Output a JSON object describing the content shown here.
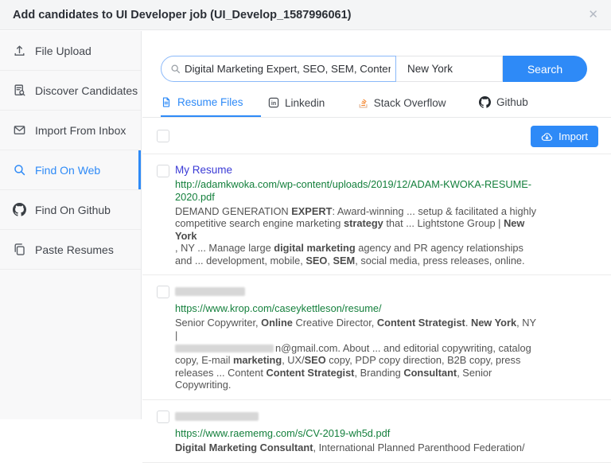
{
  "header": {
    "title": "Add candidates to UI Developer job (UI_Develop_1587996061)",
    "close_icon": "close-icon",
    "close_glyph": "✕"
  },
  "colors": {
    "accent_blue": "#2e8af7",
    "link_blue": "#3b3bd6",
    "url_green": "#15803d",
    "snippet_gray": "#545454",
    "stackoverflow_orange": "#f48024"
  },
  "sidebar": {
    "items": [
      {
        "label": "File Upload",
        "icon": "upload-icon",
        "active": false
      },
      {
        "label": "Discover Candidates",
        "icon": "document-search-icon",
        "active": false
      },
      {
        "label": "Import From Inbox",
        "icon": "envelope-icon",
        "active": false
      },
      {
        "label": "Find On Web",
        "icon": "search-icon",
        "active": true
      },
      {
        "label": "Find On Github",
        "icon": "github-icon",
        "active": false
      },
      {
        "label": "Paste Resumes",
        "icon": "clipboard-icon",
        "active": false
      }
    ]
  },
  "search": {
    "keyword_value": "Digital Marketing Expert, SEO, SEM, Conten",
    "keyword_icon": "search-icon",
    "location_value": "New York",
    "button_label": "Search"
  },
  "tabs": [
    {
      "label": "Resume Files",
      "icon": "resume-file-icon",
      "active": true
    },
    {
      "label": "Linkedin",
      "icon": "linkedin-icon",
      "active": false
    },
    {
      "label": "Stack Overflow",
      "icon": "stackoverflow-icon",
      "active": false
    },
    {
      "label": "Github",
      "icon": "github-icon",
      "active": false
    }
  ],
  "toolbar": {
    "import_label": "Import",
    "import_icon": "cloud-import-icon"
  },
  "results": [
    {
      "title": "My Resume",
      "title_redacted": false,
      "url": "http://adamkwoka.com/wp-content/uploads/2019/12/ADAM-KWOKA-RESUME-2020.pdf",
      "snippet": [
        {
          "text": "DEMAND GENERATION "
        },
        {
          "text": "EXPERT",
          "bold": true
        },
        {
          "text": ": Award-winning ... setup & facilitated a highly competitive search engine marketing "
        },
        {
          "text": "strategy",
          "bold": true
        },
        {
          "text": " that ... Lightstone Group | "
        },
        {
          "text": "New York",
          "bold": true
        },
        {
          "br": true
        },
        {
          "text": ", NY ... Manage large "
        },
        {
          "text": "digital marketing",
          "bold": true
        },
        {
          "text": " agency and PR agency relationships and ... development, mobile, "
        },
        {
          "text": "SEO",
          "bold": true
        },
        {
          "text": ", "
        },
        {
          "text": "SEM",
          "bold": true
        },
        {
          "text": ", social media, press releases, online."
        }
      ]
    },
    {
      "title": "",
      "title_redacted": true,
      "url": "https://www.krop.com/caseykettleson/resume/",
      "snippet": [
        {
          "text": "Senior Copywriter, "
        },
        {
          "text": "Online",
          "bold": true
        },
        {
          "text": " Creative Director, "
        },
        {
          "text": "Content Strategist",
          "bold": true
        },
        {
          "text": ". "
        },
        {
          "text": "New York",
          "bold": true
        },
        {
          "text": ", NY"
        },
        {
          "br": true
        },
        {
          "text": "|"
        },
        {
          "br": true
        },
        {
          "redact": true,
          "width": 124
        },
        {
          "text": "n@gmail.com. About ... and editorial copywriting, catalog copy, E-mail "
        },
        {
          "text": "marketing",
          "bold": true
        },
        {
          "text": ", UX/"
        },
        {
          "text": "SEO",
          "bold": true
        },
        {
          "text": " copy, PDP copy direction, B2B copy, press releases ... Content "
        },
        {
          "text": "Content Strategist",
          "bold": true
        },
        {
          "text": ", Branding "
        },
        {
          "text": "Consultant",
          "bold": true
        },
        {
          "text": ", Senior Copywriting."
        }
      ]
    },
    {
      "title": "",
      "title_redacted": true,
      "url": "https://www.raememg.com/s/CV-2019-wh5d.pdf",
      "snippet": [
        {
          "text": "Digital Marketing Consultant",
          "bold": true
        },
        {
          "text": ", International Planned Parenthood Federation/"
        }
      ]
    }
  ]
}
